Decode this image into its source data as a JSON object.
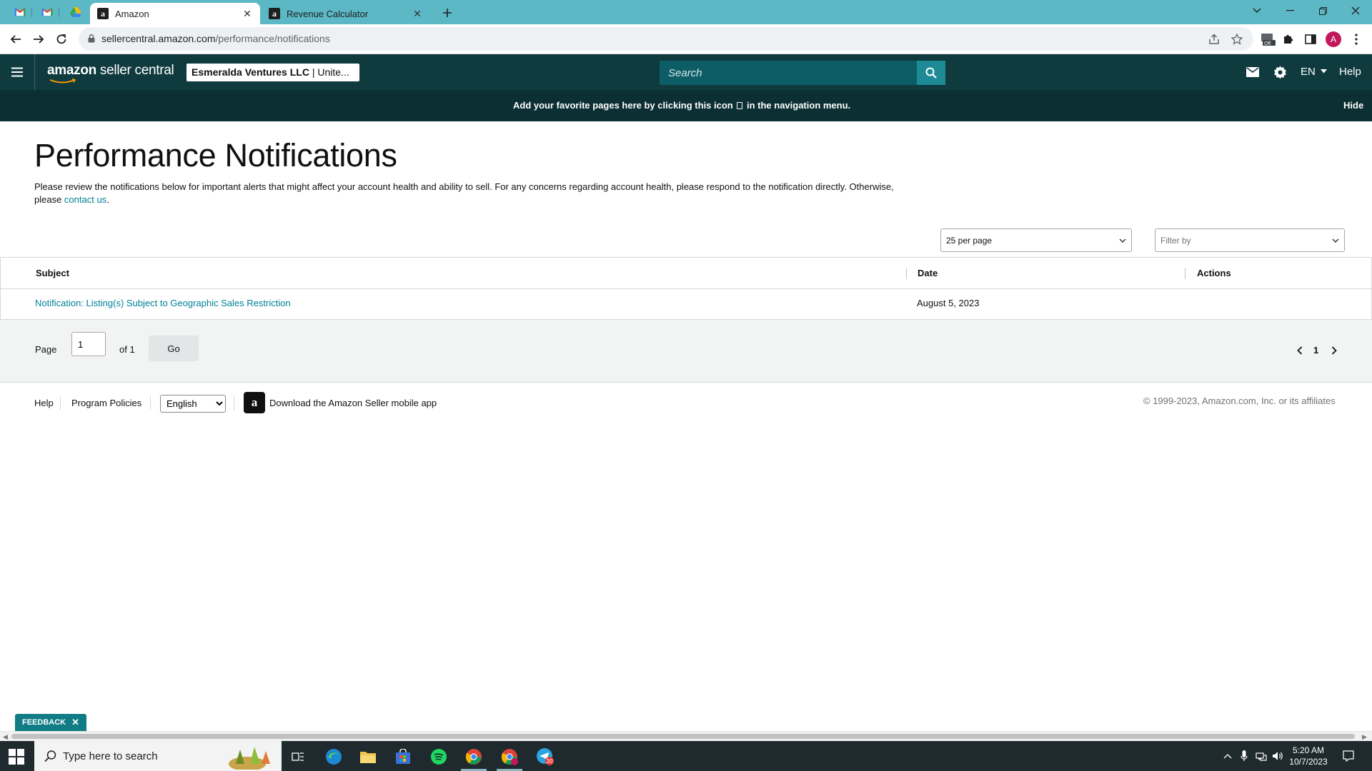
{
  "browser": {
    "tabs": [
      {
        "title": "Amazon",
        "active": true
      },
      {
        "title": "Revenue Calculator",
        "active": false
      }
    ],
    "url_domain": "sellercentral.amazon.com",
    "url_path": "/performance/notifications",
    "profile_initial": "A"
  },
  "header": {
    "logo_brand": "amazon",
    "logo_product": " seller central",
    "account_name": "Esmeralda Ventures LLC",
    "account_region": " | Unite...",
    "search_placeholder": "Search",
    "language": "EN",
    "help": "Help"
  },
  "banner": {
    "text_before": "Add your favorite pages here by clicking this icon ",
    "text_after": " in the navigation menu.",
    "hide": "Hide"
  },
  "page": {
    "title": "Performance Notifications",
    "intro": "Please review the notifications below for important alerts that might affect your account health and ability to sell. For any concerns regarding account health, please respond to the notification directly. Otherwise, please ",
    "contact_link": "contact us",
    "intro_end": "."
  },
  "controls": {
    "per_page": "25 per page",
    "filter_placeholder": "Filter by"
  },
  "table": {
    "columns": [
      "Subject",
      "Date",
      "Actions"
    ],
    "rows": [
      {
        "subject": "Notification: Listing(s) Subject to Geographic Sales Restriction",
        "date": "August 5, 2023",
        "actions": ""
      }
    ]
  },
  "pagination": {
    "page_label": "Page",
    "current_page": "1",
    "of_label": "of 1",
    "go_label": "Go",
    "page_number": "1"
  },
  "footer": {
    "help": "Help",
    "program_policies": "Program Policies",
    "language_selected": "English",
    "app_link": "Download the Amazon Seller mobile app",
    "copyright": "© 1999-2023, Amazon.com, Inc. or its affiliates"
  },
  "feedback": {
    "label": "FEEDBACK"
  },
  "taskbar": {
    "search_placeholder": "Type here to search",
    "time": "5:20 AM",
    "date": "10/7/2023",
    "telegram_badge": "20"
  },
  "colors": {
    "header_bg": "#0f3b3f",
    "banner_bg": "#0c2f33",
    "link": "#008296",
    "tabstrip": "#5bb8c4"
  }
}
